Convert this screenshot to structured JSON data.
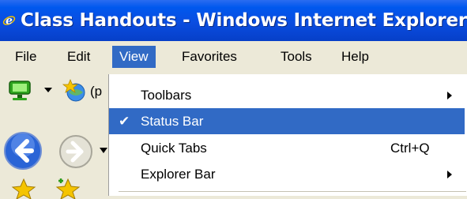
{
  "window": {
    "title": "Class Handouts - Windows Internet Explorer"
  },
  "menubar": {
    "items": [
      {
        "label": "File"
      },
      {
        "label": "Edit"
      },
      {
        "label": "View"
      },
      {
        "label": "Favorites"
      },
      {
        "label": "Tools"
      },
      {
        "label": "Help"
      }
    ]
  },
  "toolbar": {
    "partial_label": "(p"
  },
  "view_menu": {
    "items": [
      {
        "label": "Toolbars",
        "submenu": true
      },
      {
        "label": "Status Bar",
        "checked": true,
        "check_glyph": "✔"
      },
      {
        "label": "Quick Tabs",
        "shortcut": "Ctrl+Q"
      },
      {
        "label": "Explorer Bar",
        "submenu": true
      }
    ]
  },
  "colors": {
    "highlight": "#316ac5",
    "titlebar": "#0a4de0",
    "menubar": "#ece9d8"
  }
}
